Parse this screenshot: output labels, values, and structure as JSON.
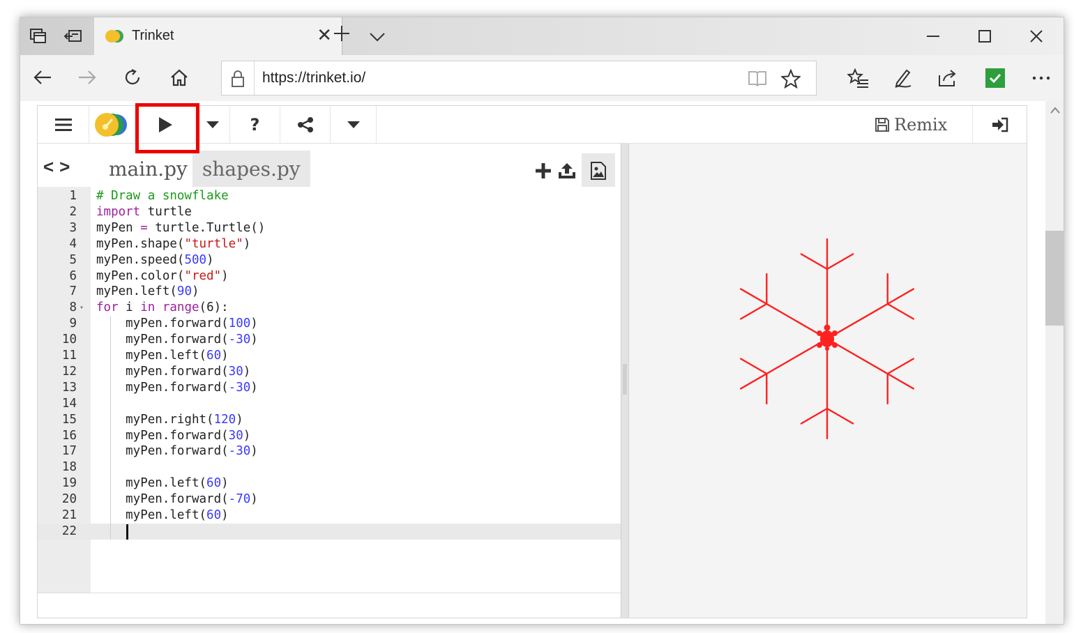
{
  "browser": {
    "tab_title": "Trinket",
    "address_url": "https://trinket.io/"
  },
  "trinket": {
    "remix_label": "Remix",
    "files": [
      {
        "name": "main.py",
        "active": true
      },
      {
        "name": "shapes.py",
        "active": false
      }
    ],
    "code_lines": [
      {
        "n": "1",
        "tokens": [
          [
            "cm",
            "# Draw a snowflake"
          ]
        ]
      },
      {
        "n": "2",
        "tokens": [
          [
            "kw",
            "import"
          ],
          [
            "",
            " turtle"
          ]
        ]
      },
      {
        "n": "3",
        "tokens": [
          [
            "",
            "myPen "
          ],
          [
            "op",
            "="
          ],
          [
            "",
            " turtle.Turtle()"
          ]
        ]
      },
      {
        "n": "4",
        "tokens": [
          [
            "",
            "myPen.shape("
          ],
          [
            "str",
            "\"turtle\""
          ],
          [
            "",
            ")"
          ]
        ]
      },
      {
        "n": "5",
        "tokens": [
          [
            "",
            "myPen.speed("
          ],
          [
            "num",
            "500"
          ],
          [
            "",
            ")"
          ]
        ]
      },
      {
        "n": "6",
        "tokens": [
          [
            "",
            "myPen.color("
          ],
          [
            "str",
            "\"red\""
          ],
          [
            "",
            ")"
          ]
        ]
      },
      {
        "n": "7",
        "tokens": [
          [
            "",
            "myPen.left("
          ],
          [
            "num",
            "90"
          ],
          [
            "",
            ")"
          ]
        ]
      },
      {
        "n": "8",
        "fold": true,
        "tokens": [
          [
            "kw",
            "for"
          ],
          [
            "",
            " i "
          ],
          [
            "kw",
            "in"
          ],
          [
            "",
            " "
          ],
          [
            "kw",
            "range"
          ],
          [
            "",
            "(6):"
          ]
        ]
      },
      {
        "n": "9",
        "tokens": [
          [
            "",
            "    myPen.forward("
          ],
          [
            "num",
            "100"
          ],
          [
            "",
            ")"
          ]
        ]
      },
      {
        "n": "10",
        "tokens": [
          [
            "",
            "    myPen.forward("
          ],
          [
            "num",
            "-30"
          ],
          [
            "",
            ")"
          ]
        ]
      },
      {
        "n": "11",
        "tokens": [
          [
            "",
            "    myPen.left("
          ],
          [
            "num",
            "60"
          ],
          [
            "",
            ")"
          ]
        ]
      },
      {
        "n": "12",
        "tokens": [
          [
            "",
            "    myPen.forward("
          ],
          [
            "num",
            "30"
          ],
          [
            "",
            ")"
          ]
        ]
      },
      {
        "n": "13",
        "tokens": [
          [
            "",
            "    myPen.forward("
          ],
          [
            "num",
            "-30"
          ],
          [
            "",
            ")"
          ]
        ]
      },
      {
        "n": "14",
        "tokens": []
      },
      {
        "n": "15",
        "tokens": [
          [
            "",
            "    myPen.right("
          ],
          [
            "num",
            "120"
          ],
          [
            "",
            ")"
          ]
        ]
      },
      {
        "n": "16",
        "tokens": [
          [
            "",
            "    myPen.forward("
          ],
          [
            "num",
            "30"
          ],
          [
            "",
            ")"
          ]
        ]
      },
      {
        "n": "17",
        "tokens": [
          [
            "",
            "    myPen.forward("
          ],
          [
            "num",
            "-30"
          ],
          [
            "",
            ")"
          ]
        ]
      },
      {
        "n": "18",
        "tokens": []
      },
      {
        "n": "19",
        "tokens": [
          [
            "",
            "    myPen.left("
          ],
          [
            "num",
            "60"
          ],
          [
            "",
            ")"
          ]
        ]
      },
      {
        "n": "20",
        "tokens": [
          [
            "",
            "    myPen.forward("
          ],
          [
            "num",
            "-70"
          ],
          [
            "",
            ")"
          ]
        ]
      },
      {
        "n": "21",
        "tokens": [
          [
            "",
            "    myPen.left("
          ],
          [
            "num",
            "60"
          ],
          [
            "",
            ")"
          ]
        ]
      },
      {
        "n": "22",
        "current": true,
        "tokens": []
      }
    ],
    "output": {
      "drawing": "snowflake",
      "pen_color": "#ff2020"
    }
  },
  "colors": {
    "highlight_box": "#ee0000",
    "keyword": "#a020a0",
    "comment": "#1a9a1a",
    "number": "#3a3aff",
    "string": "#c41a16",
    "check_green": "#2e9e3e"
  },
  "icons": [
    "tab-actions-icon",
    "tab-back-icon",
    "trinket-favicon",
    "close-tab-icon",
    "new-tab-icon",
    "tab-list-icon",
    "minimize-icon",
    "maximize-icon",
    "close-window-icon",
    "back-arrow-icon",
    "forward-arrow-icon",
    "refresh-icon",
    "home-icon",
    "lock-icon",
    "reader-view-icon",
    "favorite-star-icon",
    "favorites-list-icon",
    "pen-icon",
    "share-icon",
    "extension-check-icon",
    "more-icon",
    "menu-icon",
    "trinket-logo-icon",
    "play-icon",
    "dropdown-caret-icon",
    "help-icon",
    "share-nodes-icon",
    "save-icon",
    "login-icon",
    "add-file-icon",
    "upload-icon",
    "image-icon"
  ]
}
